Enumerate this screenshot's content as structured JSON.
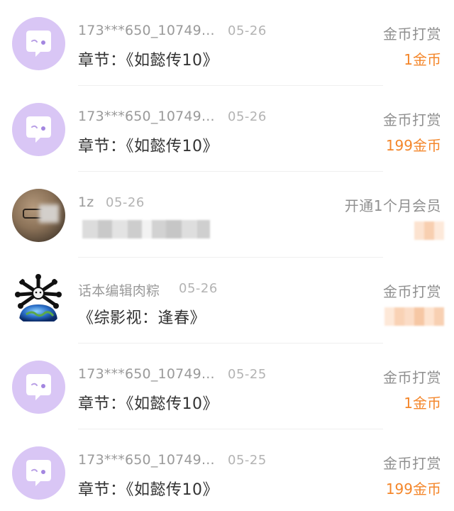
{
  "records": [
    {
      "avatar": "chat-bubble-avatar",
      "user": "173***650_10749...",
      "date": "05-26",
      "content": "章节：《如懿传10》",
      "type": "金币打赏",
      "amount": "1金币"
    },
    {
      "avatar": "chat-bubble-avatar",
      "user": "173***650_10749...",
      "date": "05-26",
      "content": "章节：《如懿传10》",
      "type": "金币打赏",
      "amount": "199金币"
    },
    {
      "avatar": "photo-avatar",
      "user": "1z",
      "date": "05-26",
      "content": "",
      "type": "开通1个月会员",
      "amount": ""
    },
    {
      "avatar": "bone-globe-avatar",
      "user": "话本编辑肉粽",
      "date": "05-26",
      "content": "《综影视：逢春》",
      "type": "金币打赏",
      "amount": ""
    },
    {
      "avatar": "chat-bubble-avatar",
      "user": "173***650_10749...",
      "date": "05-25",
      "content": "章节：《如懿传10》",
      "type": "金币打赏",
      "amount": "1金币"
    },
    {
      "avatar": "chat-bubble-avatar",
      "user": "173***650_10749...",
      "date": "05-25",
      "content": "章节：《如懿传10》",
      "type": "金币打赏",
      "amount": "199金币"
    }
  ],
  "colors": {
    "accent_amount": "#f4862a",
    "avatar_bubble_bg": "#d9c6f5",
    "text_primary": "#333333",
    "text_secondary": "#9a9a9a"
  }
}
